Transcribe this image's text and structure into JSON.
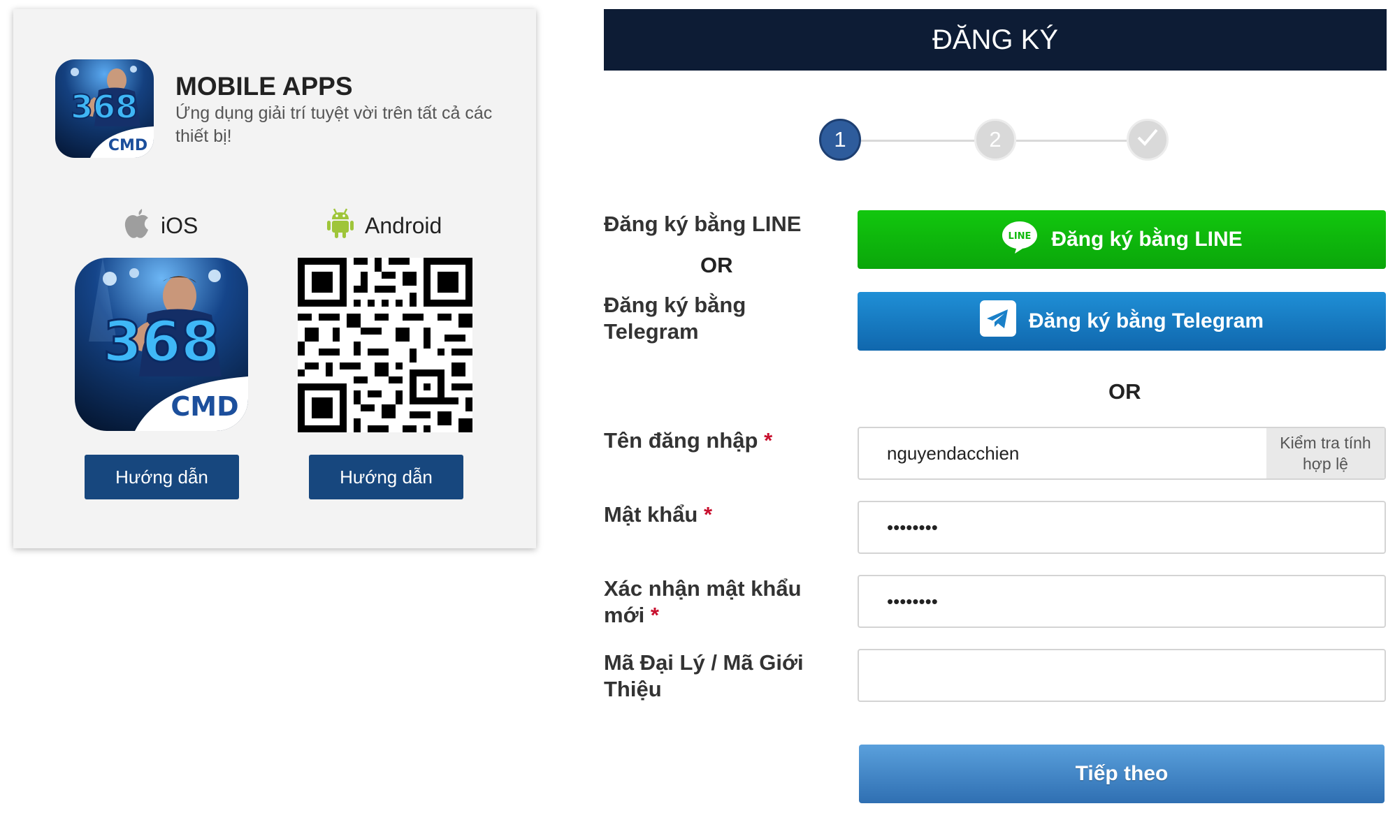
{
  "apps": {
    "title": "MOBILE APPS",
    "subtitle": "Ứng dụng giải trí tuyệt vời trên tất cả các thiết bị!",
    "app_icon_number": "368",
    "app_icon_brand": "CMD",
    "ios_label": "iOS",
    "android_label": "Android",
    "ios_guide_label": "Hướng dẫn",
    "android_guide_label": "Hướng dẫn"
  },
  "register": {
    "header": "ĐĂNG KÝ",
    "steps": [
      "1",
      "2",
      "✓"
    ],
    "line_label": "Đăng ký bằng LINE",
    "or_1": "OR",
    "telegram_label": "Đăng ký bằng Telegram",
    "line_button": "Đăng ký bằng LINE",
    "line_logo_text": "LINE",
    "telegram_button": "Đăng ký bằng Telegram",
    "or_2": "OR",
    "username_label": "Tên đăng nhập",
    "username_value": "nguyendacchien",
    "check_button": "Kiểm tra tính hợp lệ",
    "password_label": "Mật khẩu",
    "password_value": "••••••••",
    "confirm_label": "Xác nhận mật khẩu mới",
    "confirm_value": "••••••••",
    "agent_label": "Mã Đại Lý / Mã Giới Thiệu",
    "agent_value": "",
    "required_mark": "*",
    "next_button": "Tiếp theo"
  },
  "colors": {
    "header_bg": "#0d1c35",
    "guide_button": "#17477e",
    "line_green": "#0fb90c",
    "telegram_blue": "#1a80c8",
    "step_active": "#2e5c9c",
    "required": "#c8102e"
  },
  "icons": [
    "apple-icon",
    "android-icon",
    "line-logo-icon",
    "telegram-logo-icon",
    "check-icon",
    "qr-code"
  ]
}
